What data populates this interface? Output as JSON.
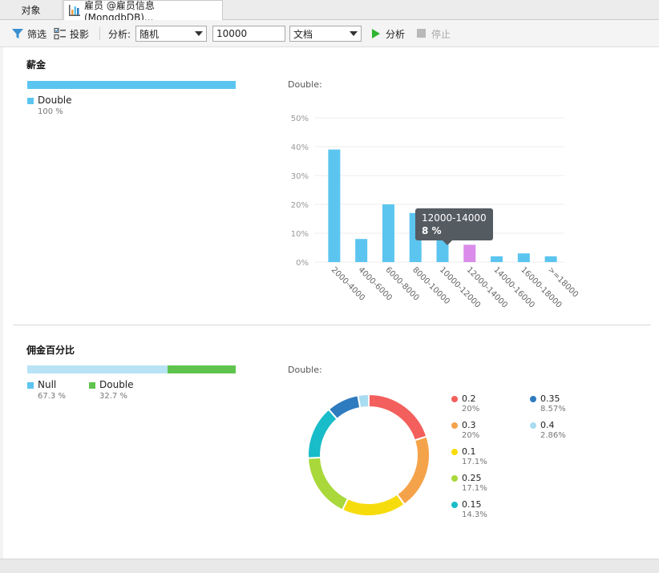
{
  "tabs": [
    {
      "label": "对象"
    },
    {
      "label": "雇员 @雇员信息 (MongdbDB)..."
    }
  ],
  "toolbar": {
    "filter_label": "筛选",
    "projection_label": "投影",
    "analyze_label": "分析:",
    "sample_mode": "随机",
    "sample_size": "10000",
    "doc_mode": "文档",
    "run_label": "分析",
    "stop_label": "停止"
  },
  "colors": {
    "accent": "#5bc5f0",
    "double_green": "#5fc44e",
    "null_blue": "#b7e3f5",
    "highlight": "#da8cea",
    "run_green": "#2fb52f"
  },
  "salary": {
    "title": "薪金",
    "type_bar": [
      {
        "name": "Double",
        "pct_text": "100 %",
        "fraction": 1.0,
        "color": "#5bc5f0"
      }
    ],
    "chart_label": "Double:",
    "tooltip": {
      "range": "12000-14000",
      "value": "8 %"
    }
  },
  "commission": {
    "title": "佣金百分比",
    "type_bar": [
      {
        "name": "Null",
        "pct_text": "67.3 %",
        "fraction": 0.673,
        "color": "#b7e3f5",
        "legend_color": "#5bc5f0"
      },
      {
        "name": "Double",
        "pct_text": "32.7 %",
        "fraction": 0.327,
        "color": "#5fc44e",
        "legend_color": "#5fc44e"
      }
    ],
    "chart_label": "Double:"
  },
  "chart_data": [
    {
      "type": "bar",
      "categories": [
        "2000-4000",
        "4000-6000",
        "6000-8000",
        "8000-10000",
        "10000-12000",
        "12000-14000",
        "14000-16000",
        "16000-18000",
        ">=18000"
      ],
      "values": [
        39,
        8,
        20,
        17,
        11,
        6,
        2,
        3,
        2
      ],
      "highlight_index": 5,
      "yticks": [
        "0%",
        "10%",
        "20%",
        "30%",
        "40%",
        "50%"
      ],
      "ylim": [
        0,
        50
      ]
    },
    {
      "type": "pie",
      "slices": [
        {
          "label": "0.2",
          "pct": "20%",
          "value": 20,
          "color": "#f25f5c"
        },
        {
          "label": "0.3",
          "pct": "20%",
          "value": 20,
          "color": "#f5a34b"
        },
        {
          "label": "0.1",
          "pct": "17.1%",
          "value": 17.1,
          "color": "#f7dc0d"
        },
        {
          "label": "0.25",
          "pct": "17.1%",
          "value": 17.1,
          "color": "#a8d83a"
        },
        {
          "label": "0.15",
          "pct": "14.3%",
          "value": 14.3,
          "color": "#19bcc9"
        },
        {
          "label": "0.35",
          "pct": "8.57%",
          "value": 8.57,
          "color": "#2f7bbf"
        },
        {
          "label": "0.4",
          "pct": "2.86%",
          "value": 2.86,
          "color": "#a9dcf1"
        }
      ]
    }
  ]
}
